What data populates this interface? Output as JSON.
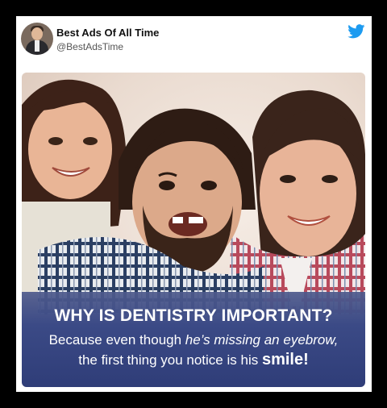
{
  "tweet": {
    "author_name": "Best Ads Of All Time",
    "author_handle": "@BestAdsTime",
    "platform_icon": "twitter-bird-icon",
    "brand_color": "#1d9bf0"
  },
  "ad": {
    "headline": "WHY IS DENTISTRY IMPORTANT?",
    "line1_prefix": "Because even though ",
    "line1_emph": "he’s missing an eyebrow,",
    "line2_prefix": "the first thing you notice is his ",
    "line2_emph": "smile!",
    "banner_color": "#34437f"
  }
}
